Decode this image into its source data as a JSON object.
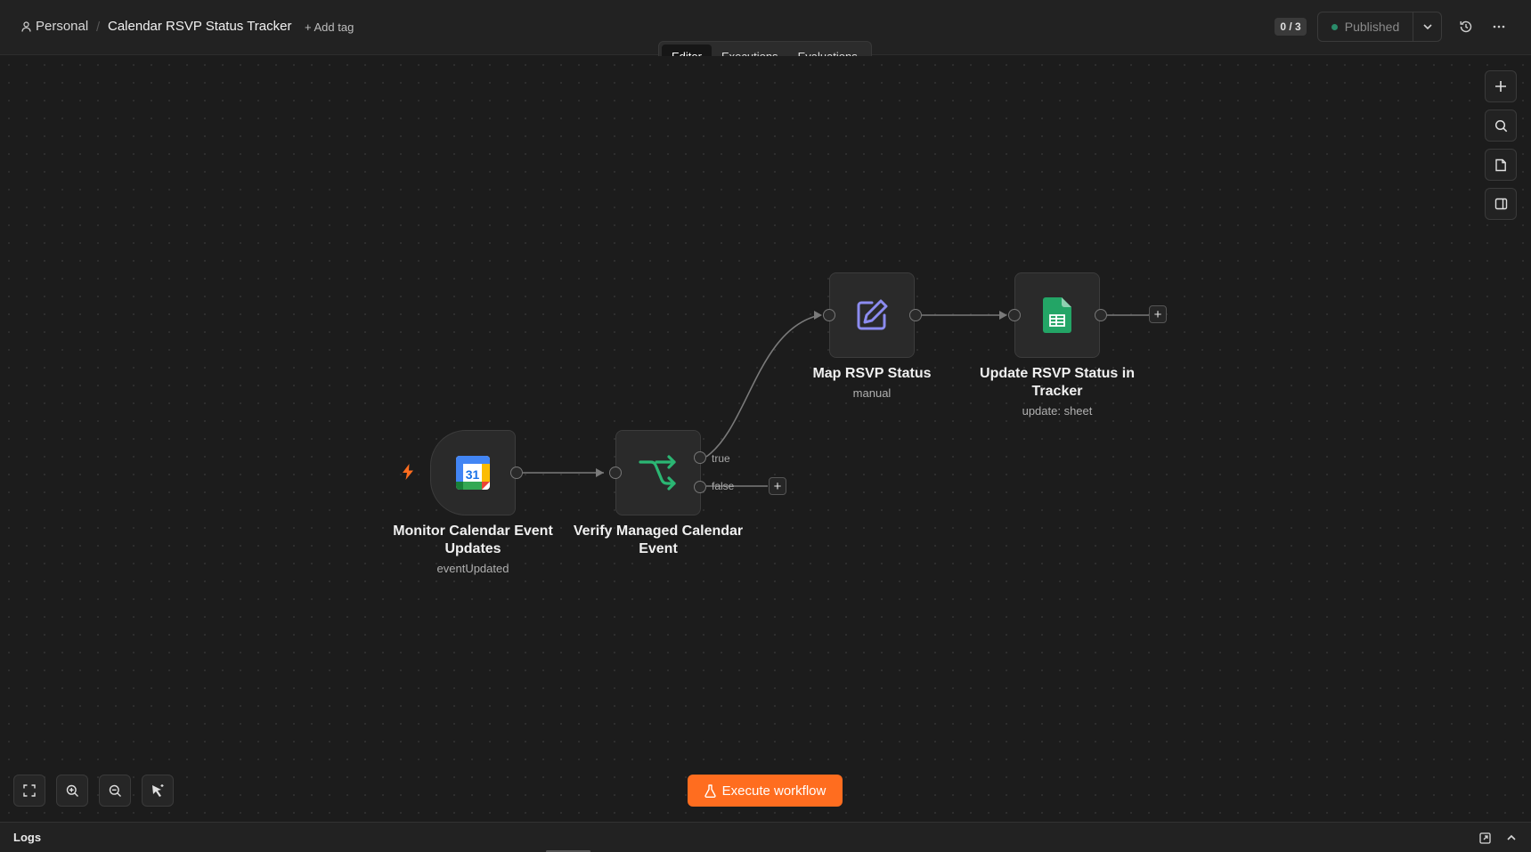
{
  "header": {
    "project": "Personal",
    "workflow_title": "Calendar RSVP Status Tracker",
    "add_tag": "+ Add tag",
    "counter": "0 / 3",
    "publish_status": "Published",
    "publish_dot_color": "#2a8c6a"
  },
  "tabs": [
    {
      "label": "Editor",
      "active": true
    },
    {
      "label": "Executions",
      "active": false
    },
    {
      "label": "Evaluations",
      "active": false
    }
  ],
  "nodes": {
    "trigger": {
      "label": "Monitor Calendar Event Updates",
      "sub": "eventUpdated",
      "icon": "google-calendar-icon",
      "icon_text": "31"
    },
    "verify": {
      "label": "Verify Managed Calendar Event",
      "sub": "",
      "icon": "if-branch-icon",
      "branch_true": "true",
      "branch_false": "false"
    },
    "map": {
      "label": "Map RSVP Status",
      "sub": "manual",
      "icon": "edit-pencil-icon"
    },
    "update": {
      "label": "Update RSVP Status in Tracker",
      "sub": "update: sheet",
      "icon": "google-sheets-icon"
    }
  },
  "toolbar": {
    "execute_label": "Execute workflow",
    "execute_color": "#ff6d1f"
  },
  "logs": {
    "title": "Logs"
  }
}
